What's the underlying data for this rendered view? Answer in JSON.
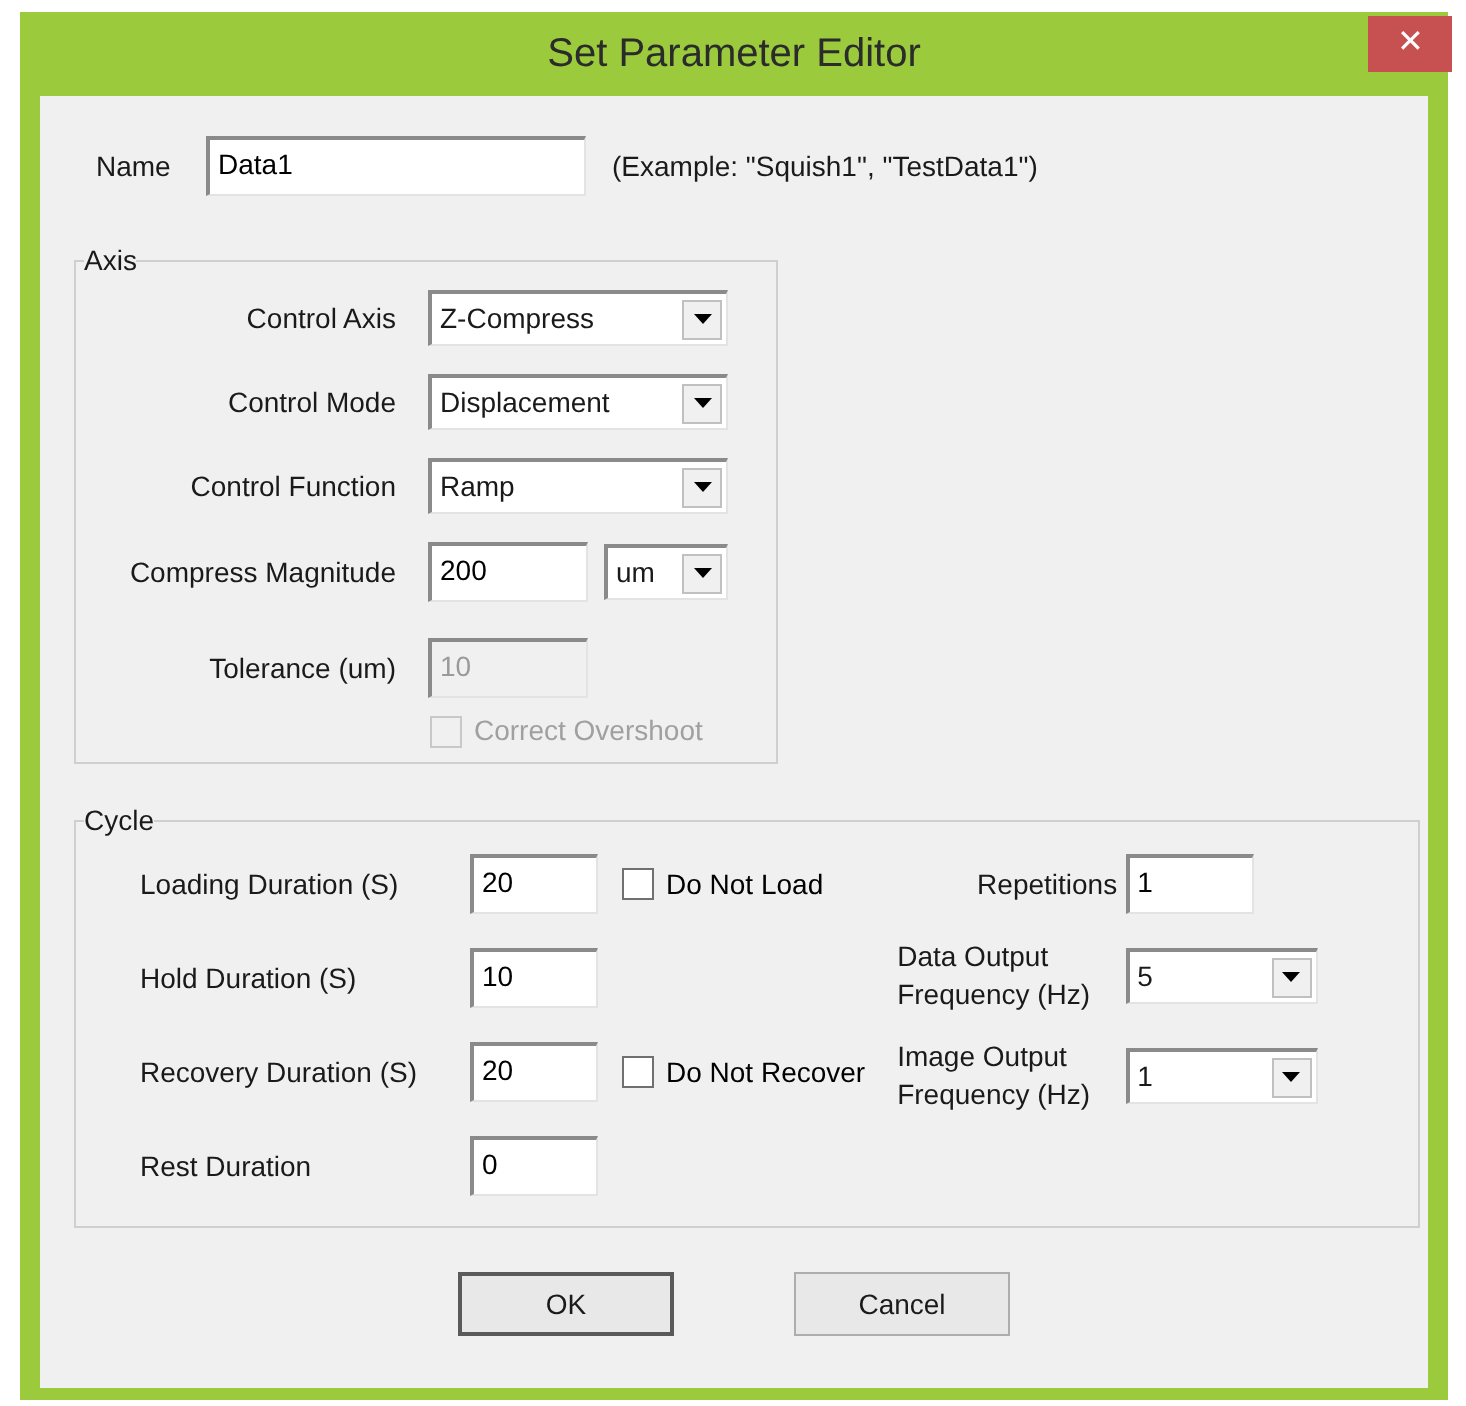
{
  "window": {
    "title": "Set Parameter Editor",
    "close": "✕"
  },
  "name_field": {
    "label": "Name",
    "value": "Data1",
    "hint": "(Example: \"Squish1\", \"TestData1\")"
  },
  "axis": {
    "title": "Axis",
    "rows": [
      {
        "kind": "combo",
        "label": "Control Axis",
        "value": "Z-Compress"
      },
      {
        "kind": "combo",
        "label": "Control Mode",
        "value": "Displacement"
      },
      {
        "kind": "combo",
        "label": "Control Function",
        "value": "Ramp"
      },
      {
        "kind": "field_combo",
        "label": "Compress Magnitude",
        "value": "200",
        "unit": "um"
      },
      {
        "kind": "field",
        "label": "Tolerance (um)",
        "value": "10",
        "disabled": true
      }
    ],
    "overshoot": {
      "label": "Correct Overshoot",
      "checked": false,
      "disabled": true
    }
  },
  "cycle": {
    "title": "Cycle",
    "left": [
      {
        "label": "Loading Duration (S)",
        "value": "20",
        "checkbox": {
          "label": "Do Not Load",
          "checked": false
        }
      },
      {
        "label": "Hold Duration (S)",
        "value": "10"
      },
      {
        "label": "Recovery Duration (S)",
        "value": "20",
        "checkbox": {
          "label": "Do Not Recover",
          "checked": false
        }
      },
      {
        "label": "Rest Duration",
        "value": "0"
      }
    ],
    "right": [
      {
        "kind": "field",
        "label": "Repetitions",
        "value": "1"
      },
      {
        "kind": "combo",
        "label": "Data Output Frequency (Hz)",
        "value": "5"
      },
      {
        "kind": "combo",
        "label": "Image Output Frequency (Hz)",
        "value": "1"
      }
    ]
  },
  "buttons": [
    {
      "label": "OK",
      "default": true
    },
    {
      "label": "Cancel",
      "default": false
    }
  ]
}
